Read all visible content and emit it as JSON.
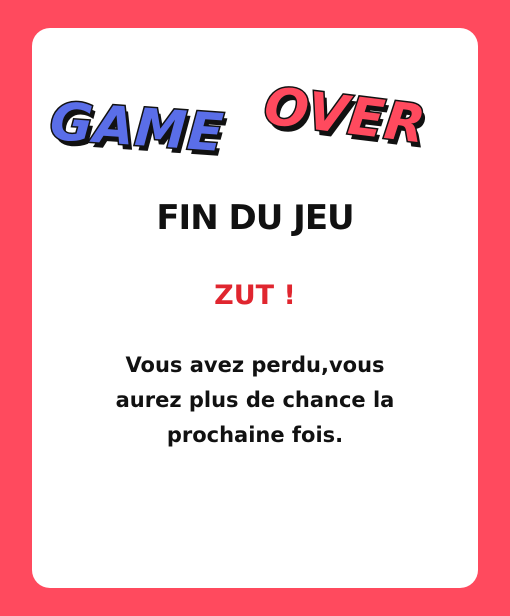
{
  "colors": {
    "background": "#ff4a5e",
    "card": "#ffffff",
    "logo_game": "#5a6ee8",
    "logo_over": "#ff4a5e",
    "accent_text": "#e0262f",
    "text": "#111111"
  },
  "logo": {
    "word1": "GAME",
    "word2": "OVER"
  },
  "subtitle": "FIN DU JEU",
  "exclaim": "ZUT !",
  "message": "Vous avez perdu,vous aurez plus de chance la prochaine fois."
}
